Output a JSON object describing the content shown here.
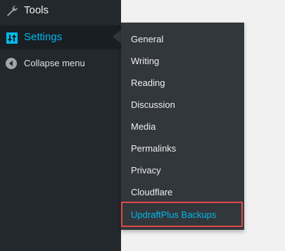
{
  "sidebar": {
    "tools_label": "Tools",
    "settings_label": "Settings",
    "collapse_label": "Collapse menu"
  },
  "submenu": {
    "items": [
      "General",
      "Writing",
      "Reading",
      "Discussion",
      "Media",
      "Permalinks",
      "Privacy",
      "Cloudflare"
    ],
    "highlighted_item": "UpdraftPlus Backups"
  },
  "colors": {
    "sidebar_bg": "#23282d",
    "submenu_bg": "#32373c",
    "active_text": "#00b9eb",
    "highlight_border": "#e04a4a"
  },
  "icons": {
    "tools": "wrench-icon",
    "settings": "sliders-icon",
    "collapse": "collapse-arrow-icon"
  }
}
